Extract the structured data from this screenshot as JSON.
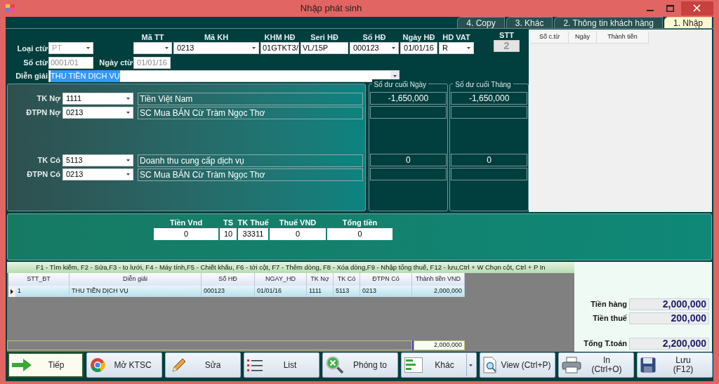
{
  "window": {
    "title": "Nhập phát sinh"
  },
  "tabs": [
    {
      "label": "4. Copy",
      "selected": false
    },
    {
      "label": "3. Khác",
      "selected": false
    },
    {
      "label": "2. Thông tin khách hàng",
      "selected": false
    },
    {
      "label": "1. Nhập",
      "selected": true
    }
  ],
  "header": {
    "loai_ctu": {
      "label": "Loại ctừ",
      "value": "PT",
      "disabled": true
    },
    "so_ctu": {
      "label": "Số ctừ",
      "value": "0001/01",
      "disabled": true
    },
    "ngay_ctu": {
      "label": "Ngày ctừ",
      "value": "01/01/16",
      "disabled": true
    },
    "top_fields": [
      {
        "label": "Mã TT",
        "kind": "combo"
      },
      {
        "label": "Mã KH",
        "value": "0213",
        "kind": "combo"
      },
      {
        "label": "KHM HĐ",
        "value": "01GTKT3/",
        "kind": "text"
      },
      {
        "label": "Seri HĐ",
        "value": "VL/15P",
        "kind": "text"
      },
      {
        "label": "Số HĐ",
        "value": "000123",
        "kind": "combo"
      },
      {
        "label": "Ngày HĐ",
        "value": "01/01/16",
        "kind": "date"
      },
      {
        "label": "HD VAT",
        "value": "R",
        "kind": "combo"
      }
    ],
    "stt": {
      "label": "STT",
      "value": "2"
    },
    "dien_giai": {
      "label": "Diễn giải",
      "value": "THU TIỀN DỊCH VỤ",
      "text_selected": true
    }
  },
  "balance_headers": [
    "Số dư cuối Ngày",
    "Số dư cuối Tháng"
  ],
  "accounts": [
    {
      "label": "TK Nợ",
      "code": "1111",
      "name": "Tiền Việt Nam",
      "balance_day": "-1,650,000",
      "balance_month": "-1,650,000"
    },
    {
      "label": "ĐTPN Nợ",
      "code": "0213",
      "name": "SC Mua BÁN Cừ Tràm Ngọc Thơ"
    },
    {
      "label": "TK Có",
      "code": "5113",
      "name": "Doanh thu cung cấp dịch vụ",
      "balance_day": "0",
      "balance_month": "0"
    },
    {
      "label": "ĐTPN Có",
      "code": "0213",
      "name": "SC Mua BÁN Cừ Tràm Ngọc Thơ"
    }
  ],
  "voucher_list": {
    "columns": [
      "Số c.từ",
      "Ngày",
      "Thành tiền"
    ]
  },
  "amounts": [
    {
      "label": "Tiền Vnd",
      "value": "0"
    },
    {
      "label": "TS",
      "value": "10"
    },
    {
      "label": "TK Thuế",
      "value": "33311"
    },
    {
      "label": "Thuế VND",
      "value": "0"
    },
    {
      "label": "Tổng tiền",
      "value": "0"
    }
  ],
  "grid": {
    "hint": "F1 - Tìm kiếm, F2 - Sửa,F3 - to lưới, F4 - Máy tính,F5 - Chiết khấu, F6 - tới cột, F7 - Thêm dòng, F8 - Xóa dòng,F9 - Nhập tổng thuế, F12 - lưu,Ctrl + W Chọn cột, Ctrl + P In",
    "columns": [
      "STT_BT",
      "Diễn giải",
      "Số HĐ",
      "NGAY_HD",
      "TK Nợ",
      "TK Có",
      "ĐTPN Có",
      "Thành tiền VND"
    ],
    "rows": [
      {
        "cells": [
          "1",
          "THU TIỀN DỊCH VỤ",
          "000123",
          "01/01/16",
          "1111",
          "5113",
          "0213",
          "2,000,000"
        ],
        "selected": true
      }
    ],
    "footer_total": "2,000,000"
  },
  "summary": [
    {
      "label": "Tiền hàng",
      "value": "2,000,000"
    },
    {
      "label": "Tiền thuế",
      "value": "200,000"
    },
    {
      "label": "Tổng T.toán",
      "value": "2,200,000"
    }
  ],
  "buttons": [
    {
      "label": "Tiếp",
      "selected": true,
      "dropdown": false
    },
    {
      "label": "Mở KTSC",
      "selected": false,
      "dropdown": false
    },
    {
      "label": "Sửa",
      "selected": false,
      "dropdown": false
    },
    {
      "label": "List",
      "selected": false,
      "dropdown": false
    },
    {
      "label": "Phóng to",
      "selected": false,
      "dropdown": false
    },
    {
      "label": "Khác",
      "selected": false,
      "dropdown": true
    },
    {
      "label": "View (Ctrl+P)",
      "selected": false,
      "dropdown": false
    },
    {
      "label": "In\n(Ctrl+O)",
      "selected": false,
      "dropdown": false
    },
    {
      "label": "Lưu\n(F12)",
      "selected": false,
      "dropdown": false
    }
  ]
}
